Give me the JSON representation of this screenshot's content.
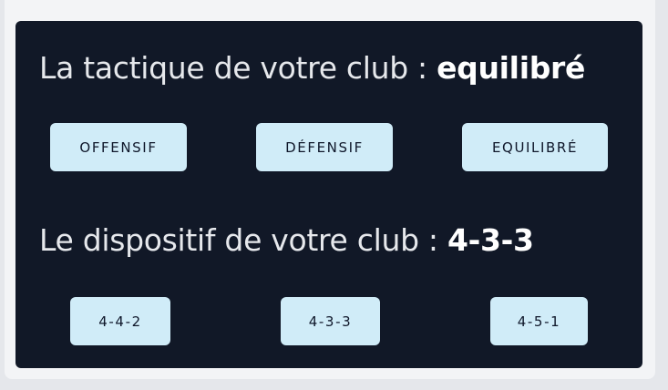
{
  "tactic": {
    "label": "La tactique de votre club : ",
    "value": "equilibré",
    "buttons": [
      "OFFENSIF",
      "DÉFENSIF",
      "EQUILIBRÉ"
    ]
  },
  "formation": {
    "label": "Le dispositif de votre club : ",
    "value": "4-3-3",
    "buttons": [
      "4-4-2",
      "4-3-3",
      "4-5-1"
    ]
  },
  "colors": {
    "panel_bg": "#111827",
    "button_bg": "#d0ecf8",
    "page_bg": "#e5e7eb"
  }
}
